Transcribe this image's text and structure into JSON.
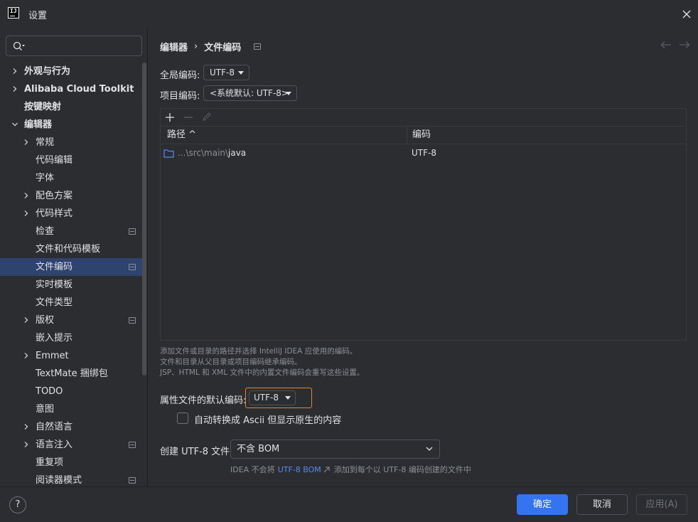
{
  "window": {
    "logo_text": "IJ",
    "title": "设置"
  },
  "sidebar": {
    "search_placeholder": "",
    "items": [
      {
        "label": "外观与行为",
        "level": 0,
        "chevron": true,
        "bold": true
      },
      {
        "label": "Alibaba Cloud Toolkit",
        "level": 0,
        "chevron": true,
        "bold": true
      },
      {
        "label": "按键映射",
        "level": 0,
        "chevron": false,
        "bold": true
      },
      {
        "label": "编辑器",
        "level": 0,
        "chevron": "down",
        "bold": true
      },
      {
        "label": "常规",
        "level": 1,
        "chevron": true
      },
      {
        "label": "代码编辑",
        "level": 1,
        "chevron": false
      },
      {
        "label": "字体",
        "level": 1,
        "chevron": false
      },
      {
        "label": "配色方案",
        "level": 1,
        "chevron": true
      },
      {
        "label": "代码样式",
        "level": 1,
        "chevron": true
      },
      {
        "label": "检查",
        "level": 1,
        "chevron": false,
        "pin": true
      },
      {
        "label": "文件和代码模板",
        "level": 1,
        "chevron": false
      },
      {
        "label": "文件编码",
        "level": 1,
        "chevron": false,
        "pin": true,
        "selected": true
      },
      {
        "label": "实时模板",
        "level": 1,
        "chevron": false
      },
      {
        "label": "文件类型",
        "level": 1,
        "chevron": false
      },
      {
        "label": "版权",
        "level": 1,
        "chevron": true,
        "pin": true
      },
      {
        "label": "嵌入提示",
        "level": 1,
        "chevron": false
      },
      {
        "label": "Emmet",
        "level": 1,
        "chevron": true
      },
      {
        "label": "TextMate 捆绑包",
        "level": 1,
        "chevron": false
      },
      {
        "label": "TODO",
        "level": 1,
        "chevron": false
      },
      {
        "label": "意图",
        "level": 1,
        "chevron": false
      },
      {
        "label": "自然语言",
        "level": 1,
        "chevron": true
      },
      {
        "label": "语言注入",
        "level": 1,
        "chevron": true,
        "pin": true
      },
      {
        "label": "重复项",
        "level": 1,
        "chevron": false
      },
      {
        "label": "阅读器模式",
        "level": 1,
        "chevron": false,
        "pin": true
      }
    ]
  },
  "breadcrumb": {
    "parent": "编辑器",
    "separator": "›",
    "current": "文件编码"
  },
  "encoding": {
    "global_label": "全局编码:",
    "global_value": "UTF-8",
    "project_label": "项目编码:",
    "project_value": "<系统默认: UTF-8>"
  },
  "table": {
    "columns": [
      "路径 ^",
      "编码"
    ],
    "rows": [
      {
        "path_prefix": "...\\src\\main\\",
        "path_last": "java",
        "encoding": "UTF-8"
      }
    ]
  },
  "hint_lines": [
    "添加文件或目录的路径并选择 IntelliJ IDEA 应使用的编码。",
    "文件和目录从父目录或项目编码继承编码。",
    "JSP、HTML 和 XML 文件中的内置文件编码会重写这些设置。"
  ],
  "properties": {
    "label": "属性文件的默认编码:",
    "value": "UTF-8",
    "checkbox_label": "自动转换成 Ascii 但显示原生的内容"
  },
  "bom": {
    "label": "创建 UTF-8 文件:",
    "value": "不含 BOM",
    "note_prefix": "IDEA 不会将",
    "note_link": "UTF-8 BOM",
    "note_suffix": "添加到每个以 UTF-8 编码创建的文件中"
  },
  "buttons": {
    "help": "?",
    "ok": "确定",
    "cancel": "取消",
    "apply": "应用(A)"
  },
  "colors": {
    "background": "#2b2d30",
    "accent": "#3574f0",
    "selection": "#2e436e",
    "highlight_border": "#e0882d",
    "link": "#548af7"
  }
}
